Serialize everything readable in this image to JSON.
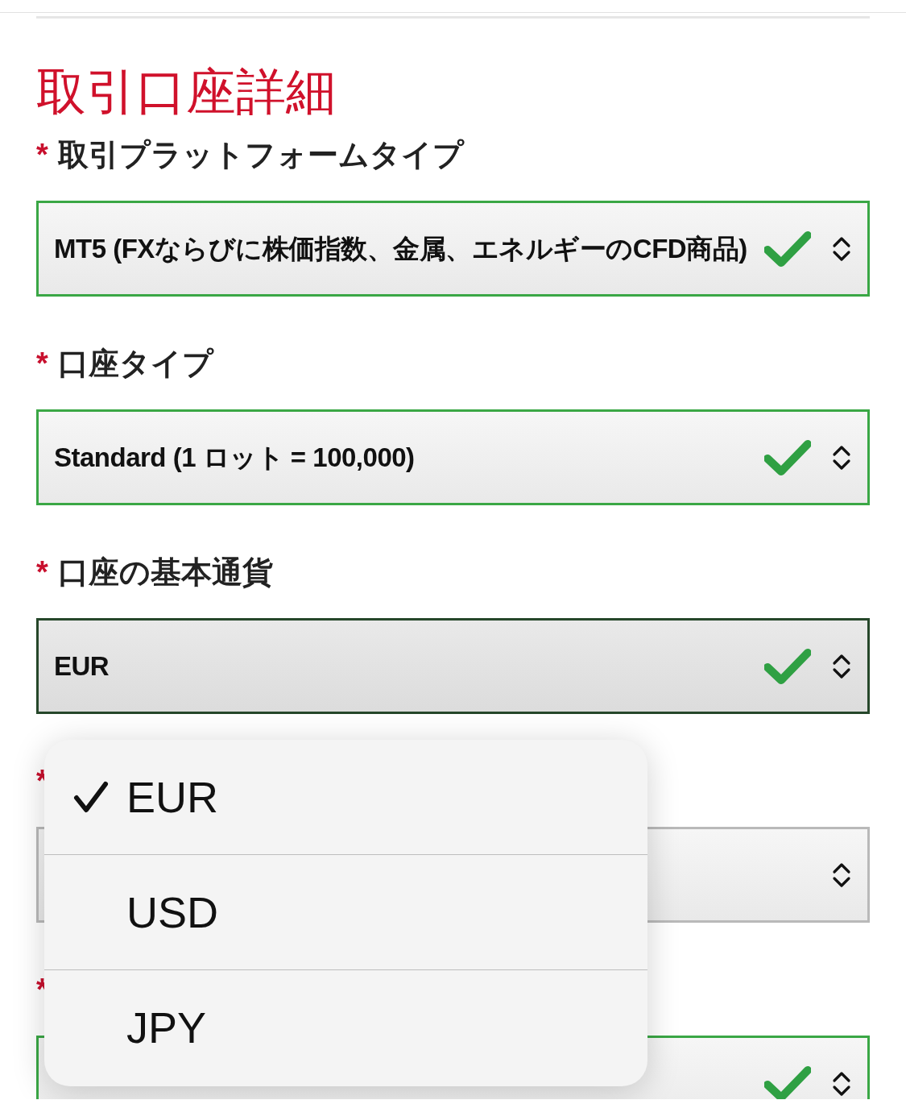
{
  "title": "取引口座詳細",
  "fields": [
    {
      "required": true,
      "marker": "*",
      "label": "取引プラットフォームタイプ",
      "value": "MT5 (FXならびに株価指数、金属、エネルギーのCFD商品)",
      "valid": true,
      "focused": false
    },
    {
      "required": true,
      "marker": "*",
      "label": "口座タイプ",
      "value": "Standard (1 ロット = 100,000)",
      "valid": true,
      "focused": false
    },
    {
      "required": true,
      "marker": "*",
      "label": "口座の基本通貨",
      "value": "EUR",
      "valid": true,
      "focused": true
    },
    {
      "required": true,
      "marker": "*",
      "valid": false,
      "focused": false
    },
    {
      "required": true,
      "marker": "*",
      "valid": true,
      "focused": false
    }
  ],
  "picker": {
    "options": [
      {
        "label": "EUR",
        "selected": true
      },
      {
        "label": "USD",
        "selected": false
      },
      {
        "label": "JPY",
        "selected": false
      }
    ]
  }
}
